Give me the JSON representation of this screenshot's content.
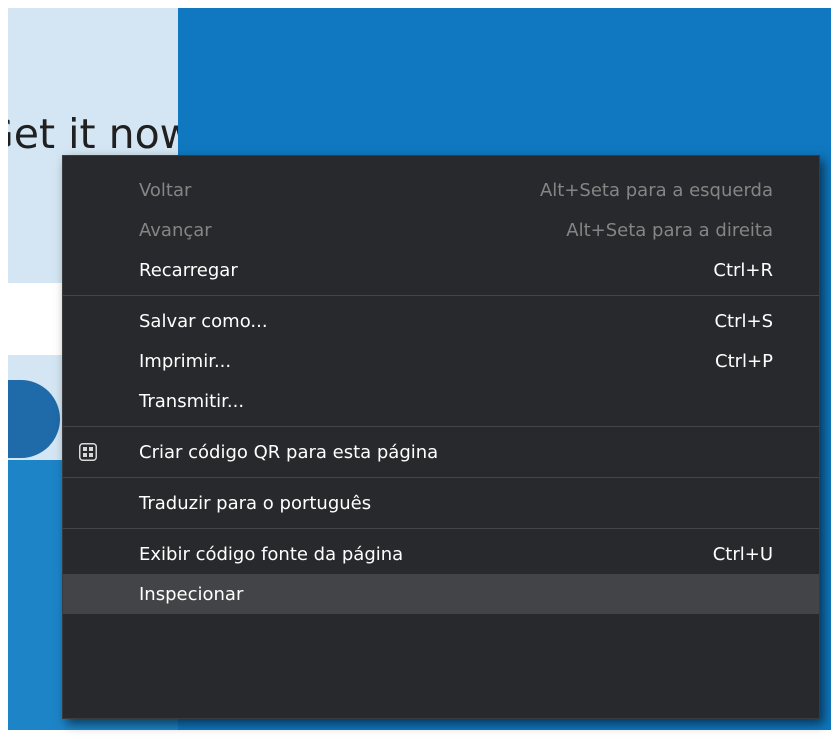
{
  "page": {
    "heading": "Get it now",
    "colors": {
      "page_bg": "#0f78c0",
      "panel": "#d4e6f3",
      "menu_bg": "#28292c",
      "highlight": "#434447"
    }
  },
  "context_menu": {
    "items": [
      {
        "label": "Voltar",
        "shortcut": "Alt+Seta para a esquerda",
        "enabled": false
      },
      {
        "label": "Avançar",
        "shortcut": "Alt+Seta para a direita",
        "enabled": false
      },
      {
        "label": "Recarregar",
        "shortcut": "Ctrl+R",
        "enabled": true
      },
      {
        "label": "Salvar como...",
        "shortcut": "Ctrl+S",
        "enabled": true
      },
      {
        "label": "Imprimir...",
        "shortcut": "Ctrl+P",
        "enabled": true
      },
      {
        "label": "Transmitir...",
        "shortcut": "",
        "enabled": true
      },
      {
        "label": "Criar código QR para esta página",
        "shortcut": "",
        "enabled": true,
        "icon": "qr-code-icon"
      },
      {
        "label": "Traduzir para o português",
        "shortcut": "",
        "enabled": true
      },
      {
        "label": "Exibir código fonte da página",
        "shortcut": "Ctrl+U",
        "enabled": true
      },
      {
        "label": "Inspecionar",
        "shortcut": "",
        "enabled": true,
        "highlighted": true
      }
    ]
  }
}
